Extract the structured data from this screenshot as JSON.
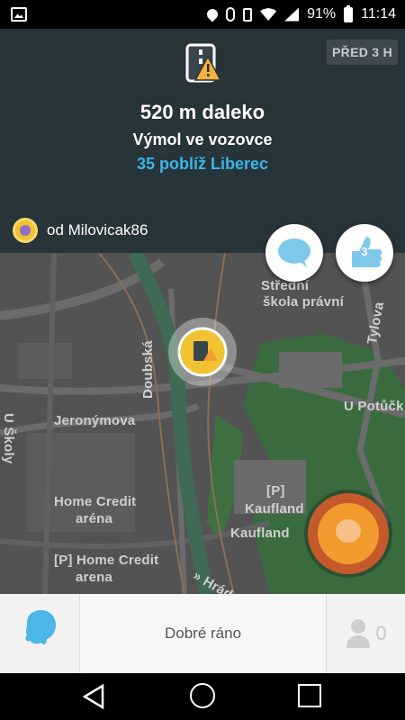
{
  "status_bar": {
    "battery": "91%",
    "time": "11:14",
    "icons": [
      "gallery-icon",
      "location-icon",
      "bluetooth-icon",
      "vibrate-icon",
      "wifi-icon",
      "signal-icon",
      "battery-icon"
    ]
  },
  "alert": {
    "icon": "pothole-warning-icon",
    "age": "PŘED 3 H",
    "distance": "520 m daleko",
    "type": "Výmol ve vozovce",
    "location": "35 poblíž Liberec",
    "reporter": "od Milovicak86"
  },
  "actions": {
    "comment_icon": "comment-icon",
    "thanks_count": "3"
  },
  "map": {
    "labels": {
      "street_doubska": "Doubská",
      "street_jeronymova": "Jeronýmova",
      "street_u_skoly": "U Školy",
      "street_tylova": "Tylova",
      "street_u_potucku": "U Potůčk",
      "street_hradek": "» Hrádek",
      "school_line1": "Střední",
      "school_line2": "škola právní",
      "home_credit_1": "Home Credit",
      "home_credit_2": "aréna",
      "home_credit_p1": "[P] Home Credit",
      "home_credit_p2": "arena",
      "kaufland_p1": "[P]",
      "kaufland_p2": "Kaufland",
      "kaufland": "Kaufland"
    }
  },
  "bottom_bar": {
    "greeting": "Dobré ráno",
    "friends_count": "0"
  },
  "colors": {
    "panel_bg": "#27343a",
    "accent_blue": "#39b7e7",
    "map_bg": "#535354",
    "report_orange": "#f29b2e"
  }
}
